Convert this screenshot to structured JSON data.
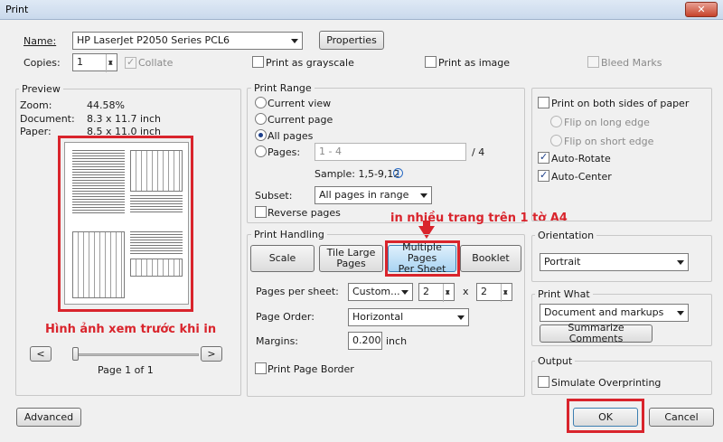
{
  "window": {
    "title": "Print",
    "close_label": "✕"
  },
  "printer": {
    "name_label": "Name:",
    "name_value": "HP LaserJet P2050 Series PCL6",
    "properties_label": "Properties",
    "copies_label": "Copies:",
    "copies_value": "1",
    "collate_label": "Collate",
    "grayscale_label": "Print as grayscale",
    "print_as_image_label": "Print as image",
    "bleed_marks_label": "Bleed Marks"
  },
  "preview": {
    "title": "Preview",
    "zoom_label": "Zoom:",
    "zoom_value": "44.58%",
    "document_label": "Document:",
    "document_value": "8.3 x 11.7 inch",
    "paper_label": "Paper:",
    "paper_value": "8.5 x 11.0 inch",
    "annotation": "Hình ảnh xem trước khi in",
    "prev_label": "<",
    "next_label": ">",
    "page_indicator": "Page 1 of 1"
  },
  "print_range": {
    "title": "Print Range",
    "current_view": "Current view",
    "current_page": "Current page",
    "all_pages": "All pages",
    "pages_label": "Pages:",
    "pages_value": "1 - 4",
    "pages_total": "/ 4",
    "sample": "Sample: 1,5-9,12",
    "subset_label": "Subset:",
    "subset_value": "All pages in range",
    "reverse_pages": "Reverse pages"
  },
  "print_handling": {
    "title": "Print Handling",
    "annotation": "in nhiều trang trên 1 tờ A4",
    "scale_label": "Scale",
    "tile_large_line1": "Tile Large",
    "tile_large_line2": "Pages",
    "multiple_line1": "Multiple Pages",
    "multiple_line2": "Per Sheet",
    "booklet_label": "Booklet",
    "pages_per_sheet_label": "Pages per sheet:",
    "pages_per_sheet_value": "Custom...",
    "cols_value": "2",
    "times": "x",
    "rows_value": "2",
    "page_order_label": "Page Order:",
    "page_order_value": "Horizontal",
    "margins_label": "Margins:",
    "margins_value": "0.200",
    "margins_unit": "inch",
    "print_page_border": "Print Page Border"
  },
  "duplex": {
    "both_sides": "Print on both sides of paper",
    "flip_long": "Flip on long edge",
    "flip_short": "Flip on short edge",
    "auto_rotate": "Auto-Rotate",
    "auto_center": "Auto-Center"
  },
  "orientation": {
    "title": "Orientation",
    "value": "Portrait"
  },
  "print_what": {
    "title": "Print What",
    "value": "Document and markups",
    "summarize_label": "Summarize Comments"
  },
  "output": {
    "title": "Output",
    "simulate_overprinting": "Simulate Overprinting"
  },
  "footer": {
    "advanced_label": "Advanced",
    "ok_label": "OK",
    "cancel_label": "Cancel"
  },
  "colors": {
    "annotation_red": "#d9242c",
    "accent_blue": "#1d3f8a"
  }
}
